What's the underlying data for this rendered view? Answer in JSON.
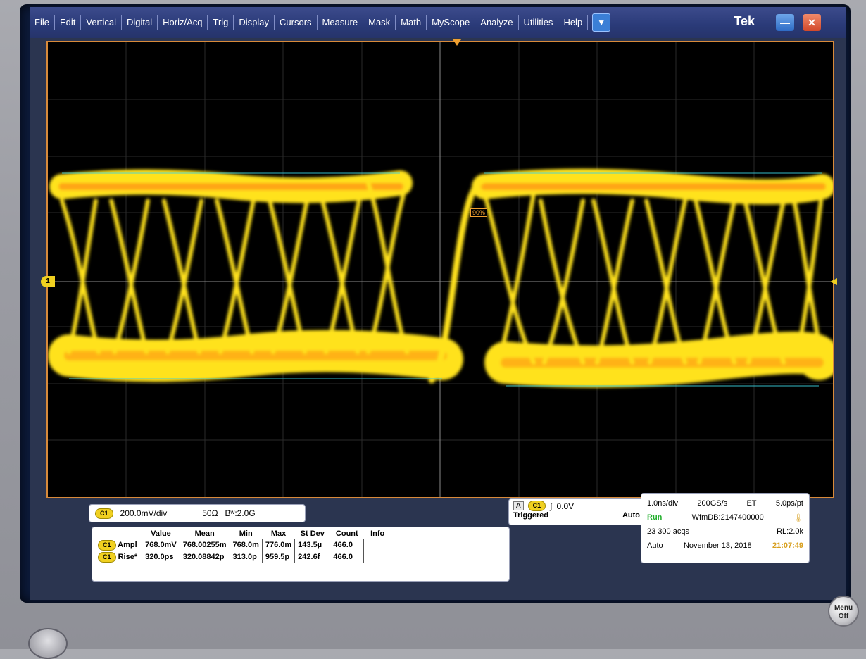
{
  "menu": {
    "items": [
      "File",
      "Edit",
      "Vertical",
      "Digital",
      "Horiz/Acq",
      "Trig",
      "Display",
      "Cursors",
      "Measure",
      "Mask",
      "Math",
      "MyScope",
      "Analyze",
      "Utilities",
      "Help"
    ],
    "brand": "Tek",
    "minimize_icon": "minimize-icon",
    "close_icon": "close-icon"
  },
  "graticule": {
    "channel_marker": "1",
    "ref_label": "90%"
  },
  "vertical": {
    "channel": "C1",
    "scale": "200.0mV/div",
    "termination": "50Ω",
    "bandwidth": "Bʷ:2.0G"
  },
  "trigger": {
    "mode_letter": "A",
    "source": "C1",
    "level": "0.0V",
    "status": "Triggered",
    "mode": "Auto"
  },
  "acquisition": {
    "timebase": "1.0ns/div",
    "sample_rate": "200GS/s",
    "mode": "ET",
    "resolution": "5.0ps/pt",
    "run_state": "Run",
    "wfmdb": "WfmDB:2147400000",
    "acqs": "23 300 acqs",
    "record_length": "RL:2.0k",
    "auto": "Auto",
    "date": "November 13, 2018",
    "time": "21:07:49"
  },
  "measurements": {
    "columns": [
      "Value",
      "Mean",
      "Min",
      "Max",
      "St Dev",
      "Count",
      "Info"
    ],
    "rows": [
      {
        "channel": "C1",
        "name": "Ampl",
        "value": "768.0mV",
        "mean": "768.00255m",
        "min": "768.0m",
        "max": "776.0m",
        "stdev": "143.5µ",
        "count": "466.0",
        "info": ""
      },
      {
        "channel": "C1",
        "name": "Rise*",
        "value": "320.0ps",
        "mean": "320.08842p",
        "min": "313.0p",
        "max": "959.5p",
        "stdev": "242.6f",
        "count": "466.0",
        "info": ""
      }
    ]
  },
  "hardware": {
    "menu_button": "Menu Off"
  }
}
